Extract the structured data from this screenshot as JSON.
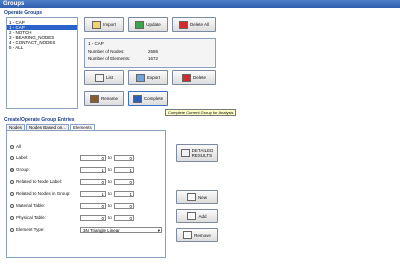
{
  "window": {
    "title": "Groups"
  },
  "operate": {
    "section_title": "Operate Groups",
    "groups": [
      "1 - CAP",
      "1 - CAP",
      "2 - NOTCH",
      "3 - BEARING_NODES",
      "4 - CONTACT_NODES",
      "5 - ALL"
    ],
    "selected_index": 1,
    "buttons": {
      "import": "Import",
      "update": "Update",
      "delete_all": "Delete All",
      "list": "List",
      "export": "Export",
      "delete": "Delete",
      "rename": "Rename",
      "complete": "Complete"
    },
    "info": {
      "name": "1 - CAP",
      "nodes_label": "Number of Nodes:",
      "nodes_value": "2586",
      "elements_label": "Number of Elements:",
      "elements_value": "1672"
    },
    "tooltip": "Complete Current Group for Analysis"
  },
  "create": {
    "section_title": "Create/Operate Group Entries",
    "tabs": [
      "Nodes",
      "Nodes Based on...",
      "Elements"
    ],
    "active_tab": 2,
    "rows": [
      {
        "label": "All",
        "from": "",
        "to": "",
        "selected": false
      },
      {
        "label": "Label:",
        "from": "0",
        "to": "0",
        "selected": false
      },
      {
        "label": "Group:",
        "from": "1",
        "to": "1",
        "selected": true
      },
      {
        "label": "Related to Node Label:",
        "from": "0",
        "to": "0",
        "selected": false
      },
      {
        "label": "Related to Nodes in Group:",
        "from": "1",
        "to": "1",
        "selected": false
      },
      {
        "label": "Material Table:",
        "from": "0",
        "to": "0",
        "selected": false
      },
      {
        "label": "Physical Table:",
        "from": "0",
        "to": "0",
        "selected": false
      },
      {
        "label": "Element Type:",
        "from": "",
        "to": "",
        "selected": false
      }
    ],
    "from_suffix": "to",
    "element_type": "3N Triangle Linear",
    "buttons": {
      "detailed_line1": "DETAILED",
      "detailed_line2": "RESULTS",
      "new": "New",
      "add": "Add",
      "remove": "Remove"
    }
  }
}
